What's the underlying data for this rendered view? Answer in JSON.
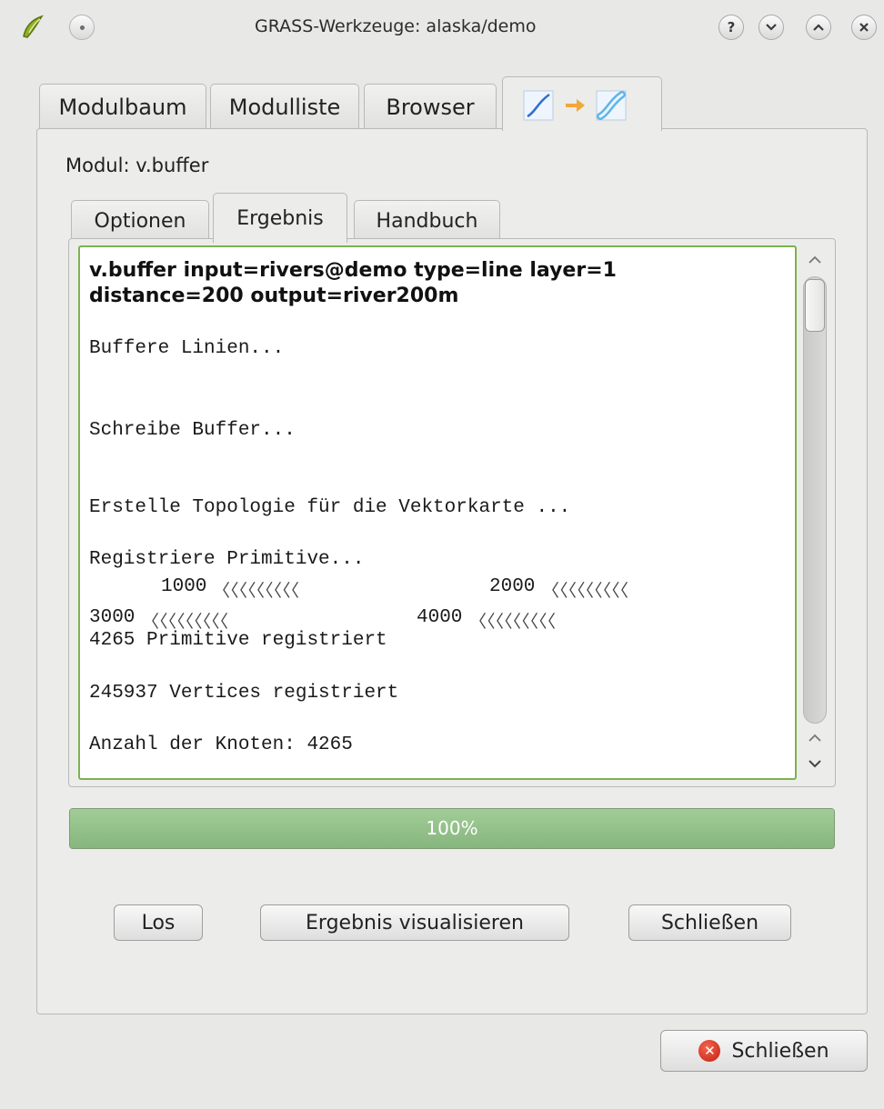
{
  "window": {
    "title": "GRASS-Werkzeuge: alaska/demo",
    "controls": [
      "?",
      "⌄",
      "⌃",
      "✕"
    ]
  },
  "outer_tabs": [
    "Modulbaum",
    "Modulliste",
    "Browser"
  ],
  "module_label": "Modul: v.buffer",
  "inner_tabs": [
    "Optionen",
    "Ergebnis",
    "Handbuch"
  ],
  "output": {
    "command_line1": "v.buffer input=rivers@demo type=line layer=1",
    "command_line2": "distance=200 output=river200m",
    "log1": "Buffere Linien...",
    "log2": "Schreibe Buffer...",
    "log3": "Erstelle Topologie für die Vektorkarte ...",
    "log4": "Registriere Primitive...",
    "count1": "1000",
    "count2": "2000",
    "count3": "3000",
    "count4": "4000",
    "ticks": "〈〈〈〈〈〈〈〈〈",
    "log5": "4265 Primitive registriert",
    "log6": "245937 Vertices registriert",
    "log7": "Anzahl der Knoten: 4265"
  },
  "progress": {
    "value": 1.0,
    "label": "100%"
  },
  "buttons": {
    "run": "Los",
    "visualize": "Ergebnis visualisieren",
    "close_inner": "Schließen",
    "close_outer": "Schließen"
  }
}
